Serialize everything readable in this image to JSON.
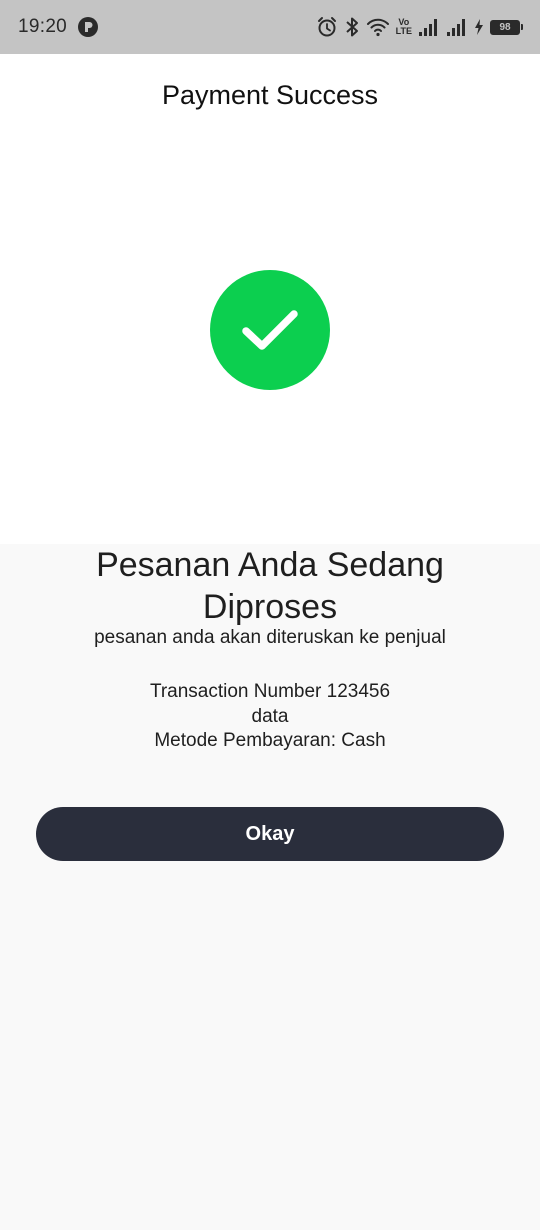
{
  "status_bar": {
    "time": "19:20",
    "battery_level": "98",
    "icons": [
      "app-notification-icon",
      "alarm-icon",
      "bluetooth-icon",
      "wifi-icon",
      "volte-icon",
      "signal-icon",
      "signal-icon",
      "charging-icon",
      "battery-icon"
    ],
    "volte_top": "Vo",
    "volte_bottom": "LTE"
  },
  "header": {
    "title": "Payment Success"
  },
  "success": {
    "icon": "checkmark-icon",
    "color": "#0ccf4f"
  },
  "message": {
    "title": "Pesanan Anda Sedang Diproses",
    "subtitle": "pesanan anda akan diteruskan ke penjual"
  },
  "transaction": {
    "number_line": "Transaction Number 123456",
    "data_line": "data",
    "payment_method_line": "Metode Pembayaran: Cash"
  },
  "actions": {
    "okay_label": "Okay",
    "button_color": "#2a2e3c"
  }
}
